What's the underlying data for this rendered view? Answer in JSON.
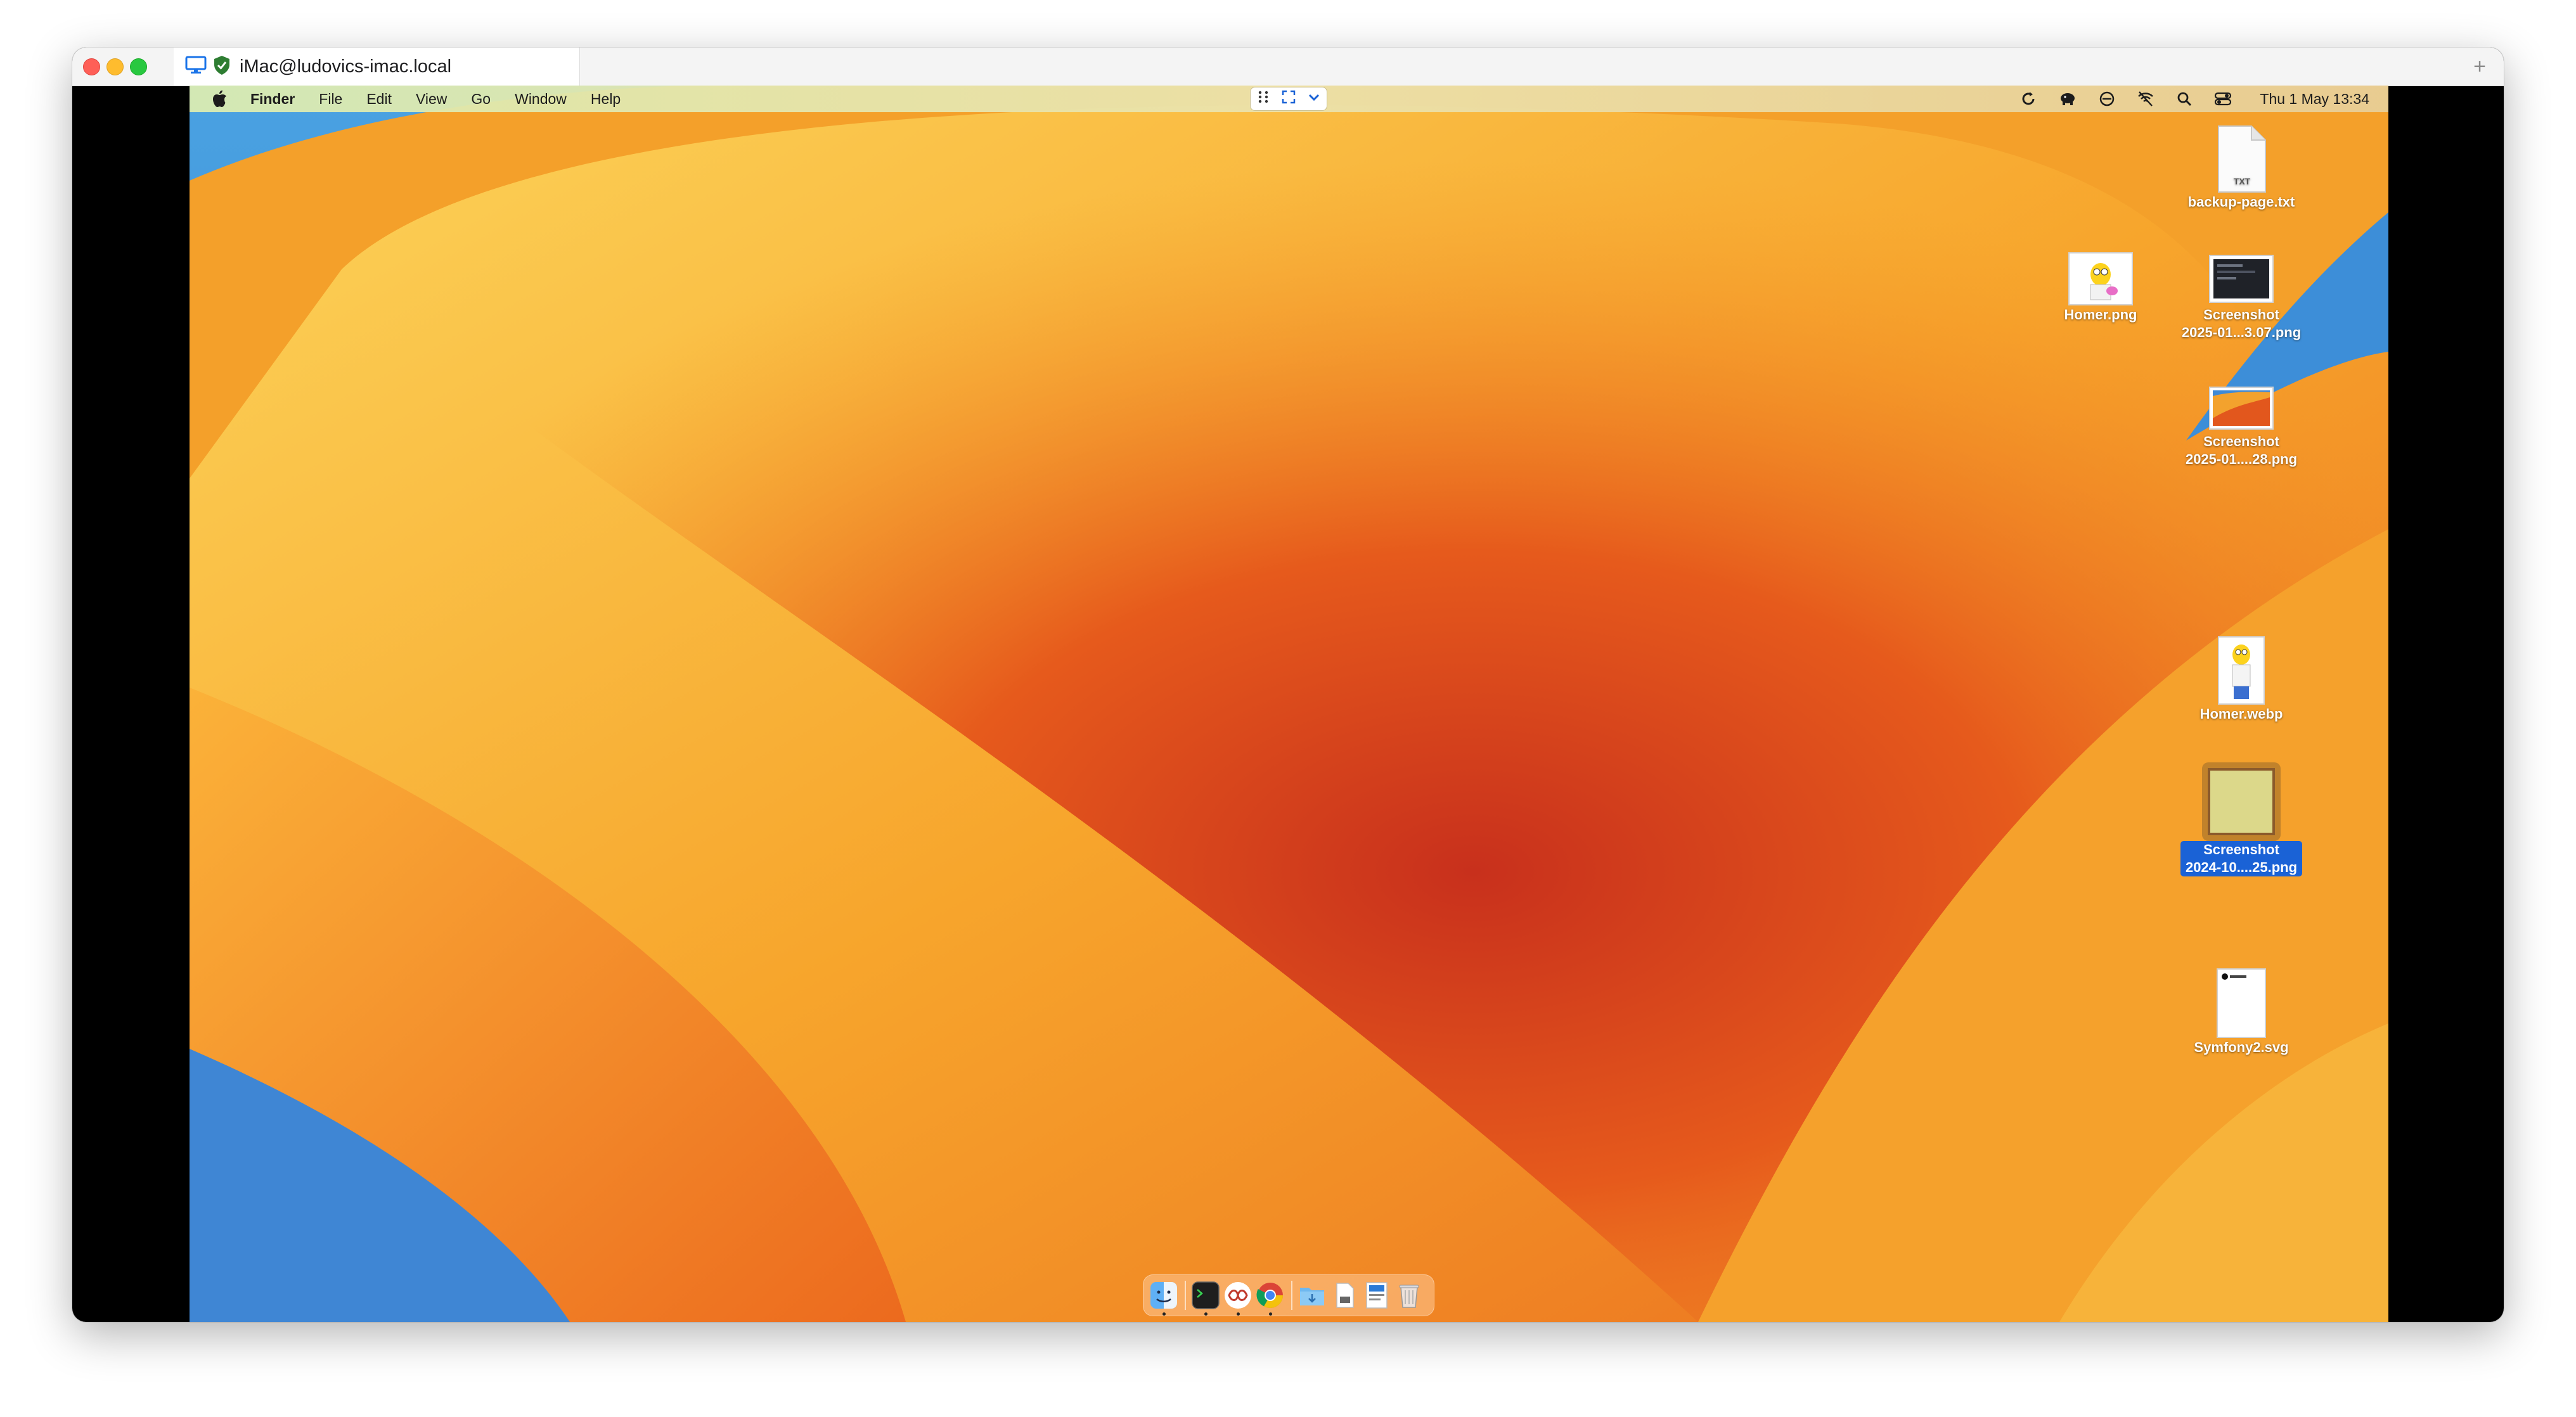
{
  "window": {
    "tab_title": "iMac@ludovics-imac.local",
    "add_tab_symbol": "+"
  },
  "menubar": {
    "app_name": "Finder",
    "items": [
      "File",
      "Edit",
      "View",
      "Go",
      "Window",
      "Help"
    ],
    "clock": "Thu 1 May  13:34"
  },
  "desktop": {
    "files": [
      {
        "name": "backup-page.txt",
        "type_badge": "TXT"
      },
      {
        "name": "Homer.png"
      },
      {
        "name": "Screenshot\n2025-01...3.07.png"
      },
      {
        "name": "Screenshot\n2025-01....28.png"
      },
      {
        "name": "Homer.webp"
      },
      {
        "name": "Screenshot\n2024-10....25.png",
        "selected": true
      },
      {
        "name": "Symfony2.svg"
      }
    ]
  },
  "dock": {
    "apps": [
      "finder",
      "terminal",
      "remote-desktop",
      "chrome",
      "downloads-folder",
      "document",
      "preview",
      "trash"
    ]
  },
  "colors": {
    "selection": "#1a62d6",
    "close": "#fe5f57",
    "minimize": "#febc2e",
    "maximize": "#28c840"
  }
}
